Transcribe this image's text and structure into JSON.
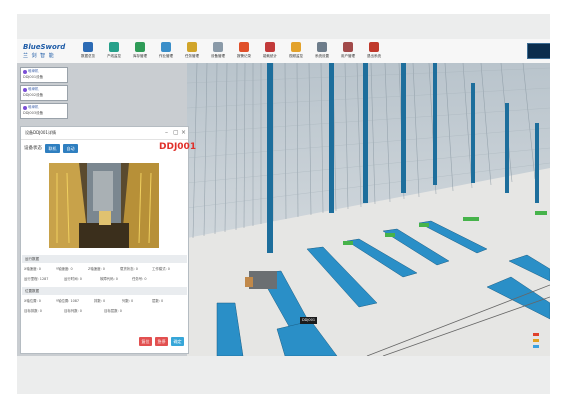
{
  "app": {
    "logo_top": "BlueSword",
    "logo_bottom": "兰 剑 智 能"
  },
  "toolbar": {
    "items": [
      {
        "label": "数据总览",
        "icon": "home-icon",
        "color": "#2c6bb5"
      },
      {
        "label": "产线监控",
        "icon": "monitor-icon",
        "color": "#27a08a"
      },
      {
        "label": "库存管理",
        "icon": "box-icon",
        "color": "#2e9b57"
      },
      {
        "label": "作业管理",
        "icon": "list-icon",
        "color": "#3a8ec9"
      },
      {
        "label": "任务管理",
        "icon": "task-icon",
        "color": "#d1a52a"
      },
      {
        "label": "设备管理",
        "icon": "device-icon",
        "color": "#8a9aa8"
      },
      {
        "label": "报警记录",
        "icon": "alarm-icon",
        "color": "#e0502a"
      },
      {
        "label": "能耗统计",
        "icon": "energy-icon",
        "color": "#c23a3a"
      },
      {
        "label": "视频监控",
        "icon": "camera-icon",
        "color": "#e3a22b"
      },
      {
        "label": "系统设置",
        "icon": "gear-icon",
        "color": "#6e7d8b"
      },
      {
        "label": "用户管理",
        "icon": "user-icon",
        "color": "#a24a4a"
      },
      {
        "label": "退出系统",
        "icon": "exit-icon",
        "color": "#c0392b"
      }
    ]
  },
  "tabs": [
    {
      "title": "堆垛机",
      "sub": "DDJ001设备"
    },
    {
      "title": "堆垛机",
      "sub": "DDJ002设备"
    },
    {
      "title": "堆垛机",
      "sub": "DDJ003设备"
    }
  ],
  "panel": {
    "title": "设备DDJ001详情",
    "device_label": "设备状态",
    "btn_online": "联机",
    "btn_auto": "自动",
    "device_id": "DDJ001",
    "section_run": "运行数据",
    "section_pos": "位置数据",
    "rows": [
      [
        "X轴速度: 0",
        "Y轴速度: 0",
        "Z轴速度: 0",
        "载货状态: 0",
        "工作模式: 0"
      ],
      [
        "运行里程: 1287",
        "运行时间: 0",
        "故障代码: 0",
        "任务号: 0"
      ],
      [
        "X轴位置: 0",
        "Y轴位置: 1087",
        "排数: 0",
        "列数: 0",
        "层数: 0"
      ],
      [
        "目标排数: 0",
        "目标列数: 0",
        "目标层数: 0"
      ]
    ],
    "actions": [
      {
        "label": "复位",
        "color": "#e25050"
      },
      {
        "label": "急停",
        "color": "#e25050"
      },
      {
        "label": "确定",
        "color": "#37a6d8"
      }
    ]
  },
  "scene": {
    "tooltip": "DDJ001",
    "rail_color": "#2a8fc7",
    "legend": [
      "入库",
      "出库",
      "故障"
    ],
    "legend_colors": [
      "#e0402a",
      "#e0a020",
      "#3aa0e0"
    ]
  }
}
